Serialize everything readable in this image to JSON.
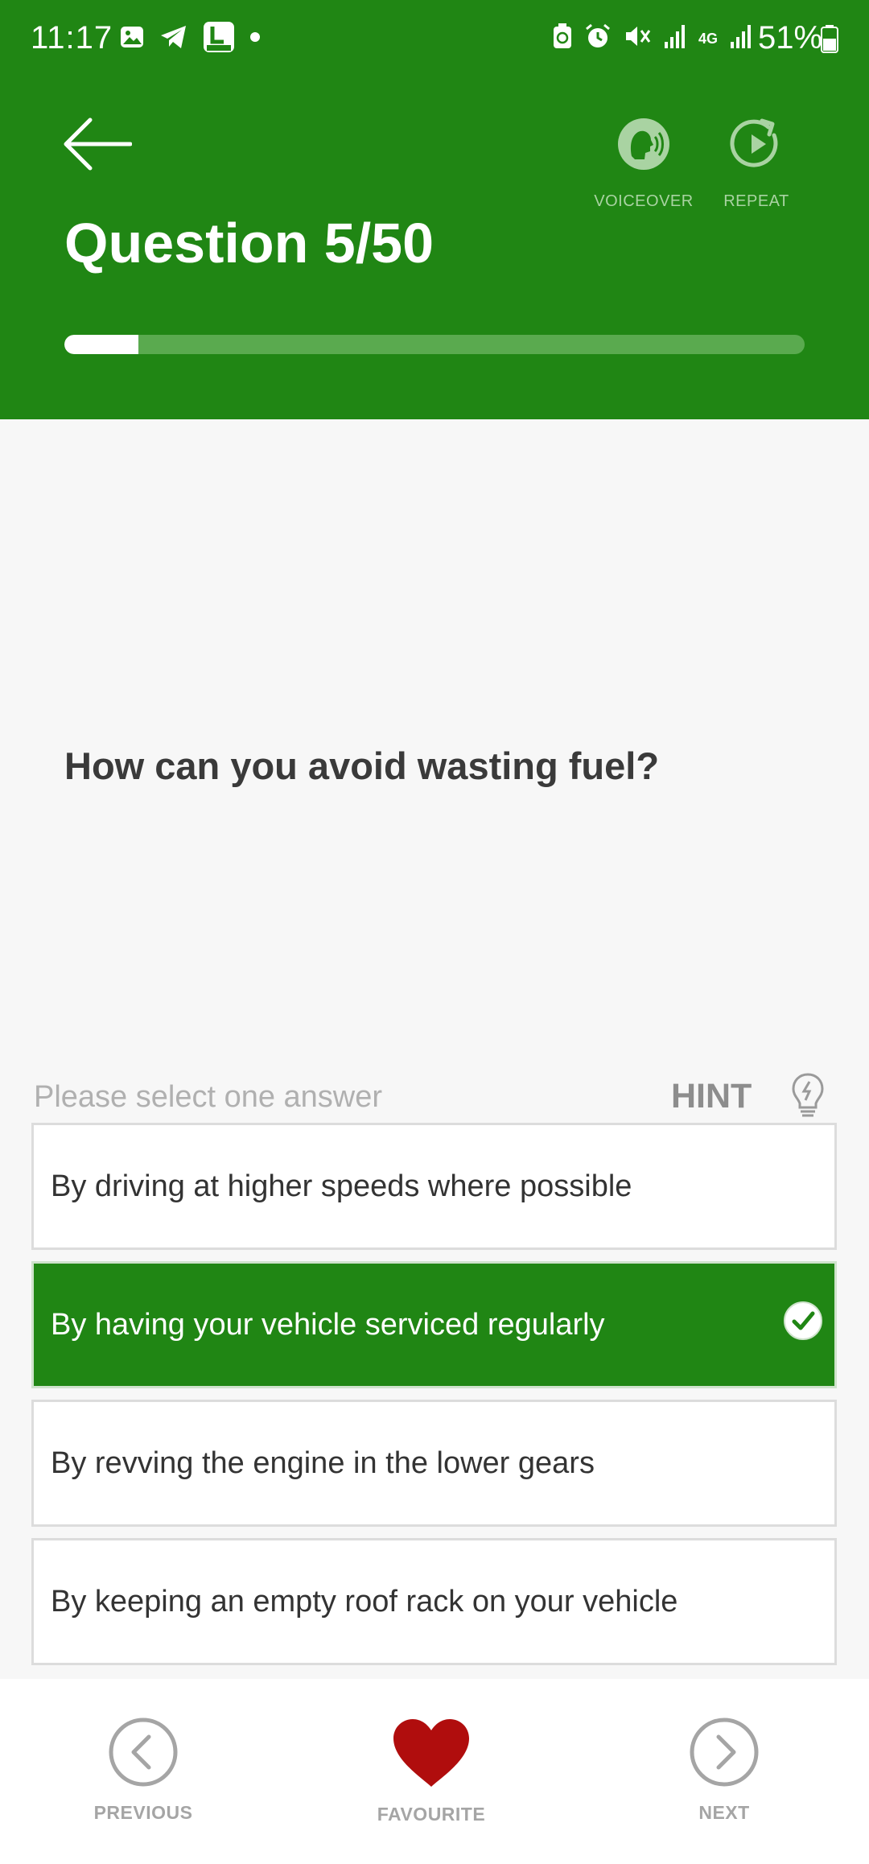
{
  "status_bar": {
    "time": "11:17",
    "battery": "51%",
    "network": "4G",
    "left_icons": [
      "gallery-icon",
      "telegram-icon",
      "app-4in1-icon",
      "notification-dot-icon"
    ],
    "right_icons": [
      "battery-saver-icon",
      "alarm-icon",
      "mute-icon",
      "signal-icon",
      "signal-icon"
    ]
  },
  "header": {
    "back_icon": "arrow-left-icon",
    "voiceover_label": "VOICEOVER",
    "repeat_label": "REPEAT",
    "question_counter": "Question 5/50",
    "progress": {
      "current": 5,
      "total": 50,
      "fraction": 0.1
    },
    "background_color": "#208614"
  },
  "question": {
    "text": "How can you avoid wasting fuel?"
  },
  "answer_section": {
    "prompt": "Please select one answer",
    "hint_label": "HINT"
  },
  "answers": [
    {
      "text": "By driving at higher speeds where possible",
      "selected": false
    },
    {
      "text": "By having your vehicle serviced regularly",
      "selected": true
    },
    {
      "text": "By revving the engine in the lower gears",
      "selected": false
    },
    {
      "text": "By keeping an empty roof rack on your vehicle",
      "selected": false
    }
  ],
  "bottom_nav": {
    "previous_label": "PREVIOUS",
    "favourite_label": "FAVOURITE",
    "next_label": "NEXT",
    "favourite_color": "#b00d0d"
  }
}
